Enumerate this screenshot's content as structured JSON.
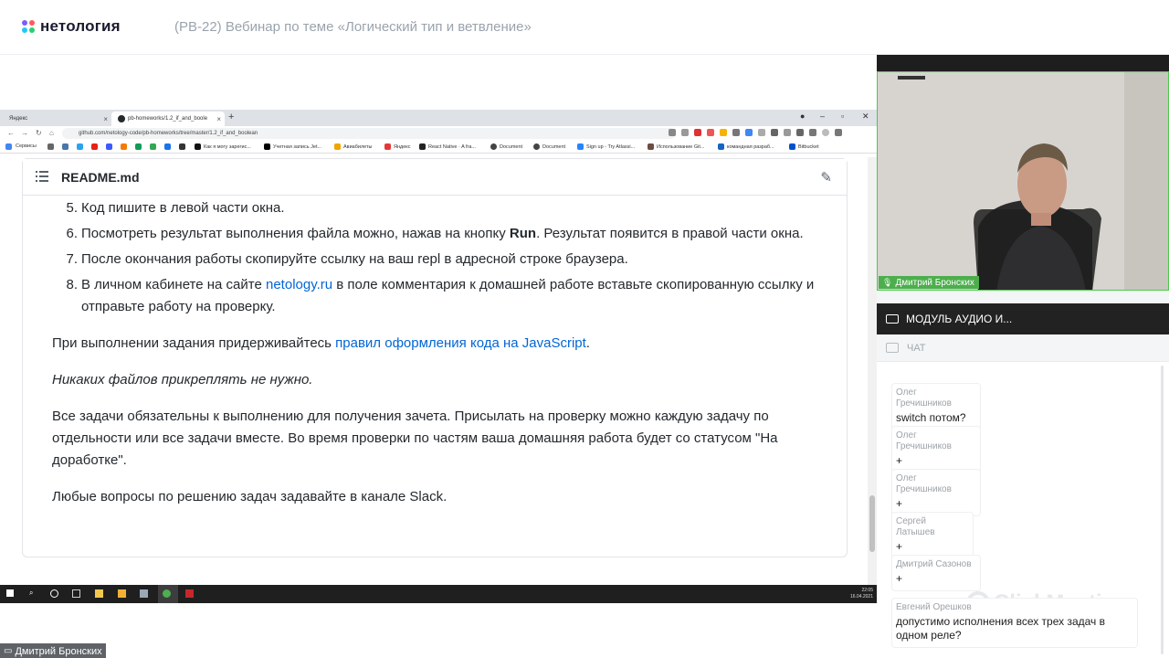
{
  "app": {
    "logo_text": "нетология",
    "webinar_title": "(PB-22) Вебинар по теме «Логический тип и ветвление»",
    "brand_colors": [
      "#7b5cff",
      "#ff5a5f",
      "#21c8f6",
      "#2ecc71"
    ]
  },
  "browser": {
    "tabs": [
      {
        "label": "Яндекс",
        "active": false
      },
      {
        "label": "pb-homeworks/1.2_if_and_boole",
        "active": true
      }
    ],
    "url": "github.com/netology-code/pb-homeworks/tree/master/1.2_if_and_boolean",
    "bookmarks": [
      "Сервисы",
      "Как я могу зарегис...",
      "Учетная запись Jet...",
      "Авиабилеты",
      "Яндекс",
      "React Native · A fra...",
      "Document",
      "Document",
      "Sign up - Try Atlassi...",
      "Использование Git...",
      "командная разраб...",
      "Bitbucket"
    ]
  },
  "readme": {
    "title": "README.md",
    "items": [
      {
        "num": "5.",
        "text": "Код пишите в левой части окна."
      },
      {
        "num": "6.",
        "pre": "Посмотреть результат выполнения файла можно, нажав на кнопку ",
        "bold": "Run",
        "post": ". Результат появится в правой части окна."
      },
      {
        "num": "7.",
        "text": "После окончания работы скопируйте ссылку на ваш repl в адресной строке браузера."
      },
      {
        "num": "8.",
        "pre": "В личном кабинете на сайте ",
        "link": "netology.ru",
        "post": " в поле комментария к домашней работе вставьте скопированную ссылку и отправьте работу на проверку."
      }
    ],
    "p1_pre": "При выполнении задания придерживайтесь ",
    "p1_link": "правил оформления кода на JavaScript",
    "p1_post": ".",
    "p2": "Никаких файлов прикреплять не нужно.",
    "p3": "Все задачи обязательны к выполнению для получения зачета. Присылать на проверку можно каждую задачу по отдельности или все задачи вместе. Во время проверки по частям ваша домашняя работа будет со статусом \"На доработке\".",
    "p4": "Любые вопросы по решению задач задавайте в канале Slack."
  },
  "taskbar": {
    "time": "22:05",
    "date": "16.04.2021"
  },
  "presenter_tag": "Дмитрий Бронских",
  "video": {
    "name": "Дмитрий Бронских"
  },
  "audio_module": "МОДУЛЬ АУДИО И...",
  "chat": {
    "title": "ЧАТ",
    "messages": [
      {
        "author": "Олег Гречишников",
        "text": "switch потом?"
      },
      {
        "author": "Олег Гречишников",
        "text": "+"
      },
      {
        "author": "Олег Гречишников",
        "text": "+"
      },
      {
        "author": "Сергей Латышев",
        "text": "+"
      },
      {
        "author": "Дмитрий Сазонов",
        "text": "+"
      },
      {
        "author": "Евгений Орешков",
        "text": "допустимо исполнения всех трех задач в одном реле?"
      }
    ],
    "watermark": "ClickMeeting"
  }
}
